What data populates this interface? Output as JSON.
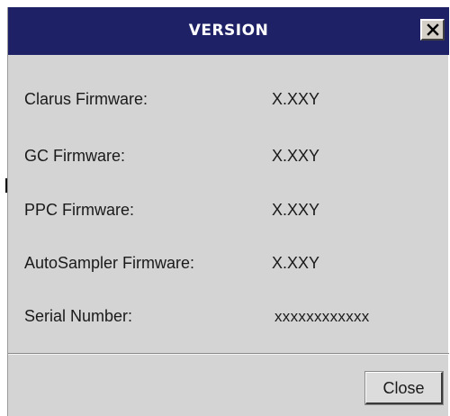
{
  "dialog": {
    "title": "VERSION",
    "close_icon": "close-x-icon"
  },
  "rows": [
    {
      "label": "Clarus Firmware:",
      "value": "X.XXY"
    },
    {
      "label": "GC Firmware:",
      "value": "X.XXY"
    },
    {
      "label": "PPC Firmware:",
      "value": "X.XXY"
    },
    {
      "label": "AutoSampler Firmware:",
      "value": "X.XXY"
    },
    {
      "label": "Serial Number:",
      "value": "xxxxxxxxxxxx"
    }
  ],
  "footer": {
    "close_label": "Close"
  },
  "colors": {
    "titlebar": "#1e2166",
    "background": "#d4d4d4"
  }
}
